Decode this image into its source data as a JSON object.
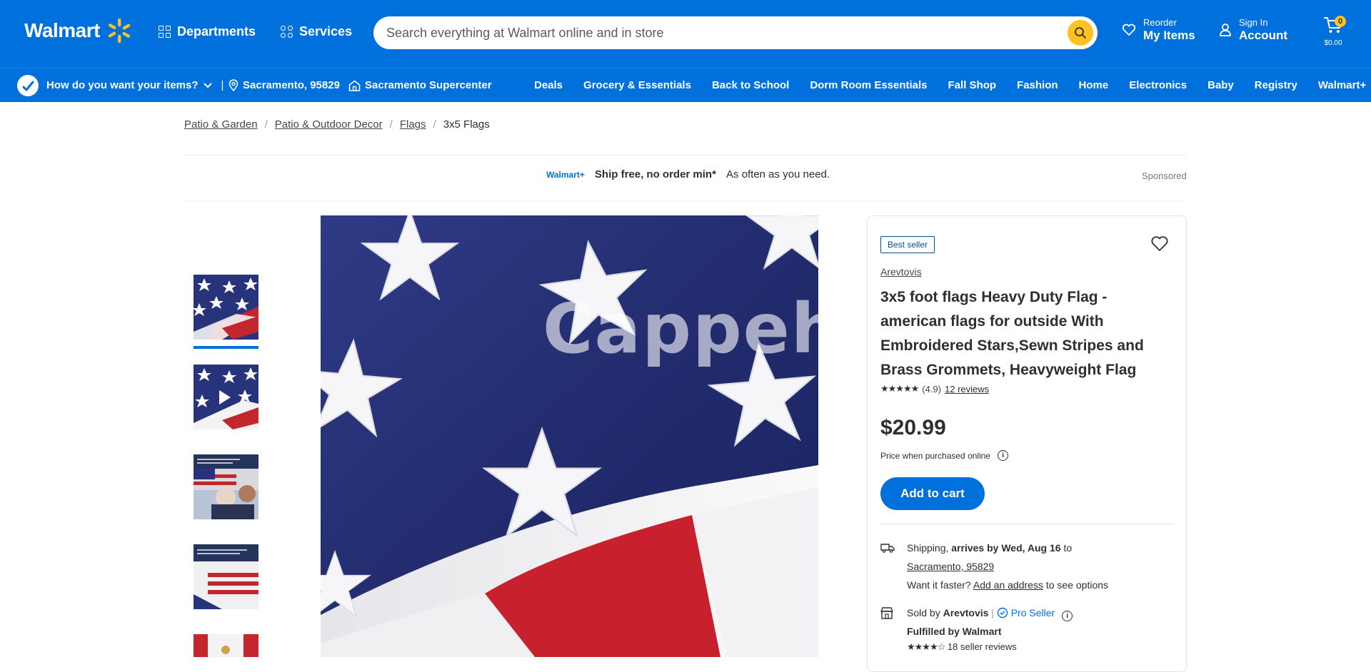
{
  "header": {
    "logo_text": "Walmart",
    "departments": "Departments",
    "services": "Services",
    "search_placeholder": "Search everything at Walmart online and in store",
    "reorder_small": "Reorder",
    "reorder_big": "My Items",
    "signin_small": "Sign In",
    "signin_big": "Account",
    "cart_count": "0",
    "cart_total": "$0.00"
  },
  "subnav": {
    "delivery_prompt": "How do you want your items?",
    "location": "Sacramento, 95829",
    "store": "Sacramento Supercenter",
    "categories": [
      "Deals",
      "Grocery & Essentials",
      "Back to School",
      "Dorm Room Essentials",
      "Fall Shop",
      "Fashion",
      "Home",
      "Electronics",
      "Baby",
      "Registry",
      "Walmart+"
    ]
  },
  "breadcrumb": [
    "Patio & Garden",
    "Patio & Outdoor Decor",
    "Flags",
    "3x5 Flags"
  ],
  "promo": {
    "logo": "Walmart+",
    "headline": "Ship free, no order min*",
    "sub": "As often as you need.",
    "sponsored": "Sponsored"
  },
  "watermark": "Cappeh",
  "product": {
    "badge": "Best seller",
    "brand": "Arevtovis",
    "title": "3x5 foot flags Heavy Duty Flag - american flags for outside With Embroidered Stars,Sewn Stripes and Brass Grommets, Heavyweight Flag",
    "rating_stars": "★★★★★",
    "rating_value": "(4.9)",
    "reviews": "12 reviews",
    "price": "$20.99",
    "price_note": "Price when purchased online",
    "add_to_cart": "Add to cart"
  },
  "shipping": {
    "label": "Shipping,",
    "arrives": "arrives by Wed, Aug 16",
    "to": "to",
    "location": "Sacramento, 95829",
    "faster": "Want it faster?",
    "add_address": "Add an address",
    "see_options": "to see options"
  },
  "seller": {
    "sold_by": "Sold by",
    "name": "Arevtovis",
    "pro": "Pro Seller",
    "fulfilled": "Fulfilled by Walmart",
    "seller_stars": "★★★★☆",
    "seller_reviews": "18 seller reviews"
  },
  "colors": {
    "brand_blue": "#0071dc",
    "spark_yellow": "#ffc220"
  }
}
